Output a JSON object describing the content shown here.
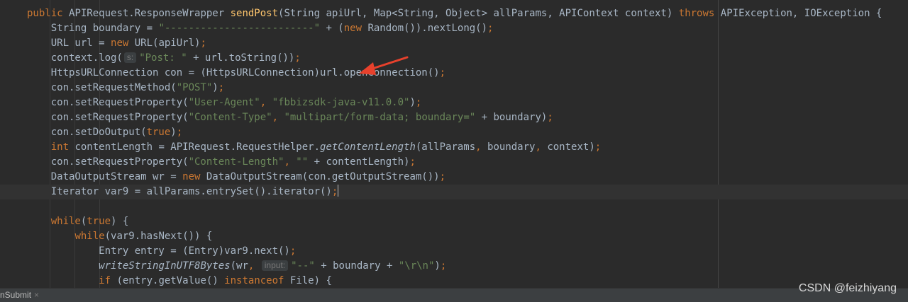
{
  "editor": {
    "lines": [
      [
        {
          "t": "public ",
          "c": "kw"
        },
        {
          "t": "APIRequest.ResponseWrapper "
        },
        {
          "t": "sendPost",
          "c": "fn"
        },
        {
          "t": "(String apiUrl, Map<String, Object> allParams, APIContext context) "
        },
        {
          "t": "throws ",
          "c": "kw"
        },
        {
          "t": "APIException, IOException {"
        }
      ],
      [
        {
          "t": "    String boundary = "
        },
        {
          "t": "\"-------------------------\"",
          "c": "str"
        },
        {
          "t": " + ("
        },
        {
          "t": "new ",
          "c": "kw"
        },
        {
          "t": "Random()).nextLong()"
        },
        {
          "t": ";",
          "c": "kw"
        }
      ],
      [
        {
          "t": "    URL url = "
        },
        {
          "t": "new ",
          "c": "kw"
        },
        {
          "t": "URL(apiUrl)"
        },
        {
          "t": ";",
          "c": "kw"
        }
      ],
      [
        {
          "t": "    context.log("
        },
        {
          "t": "s:",
          "c": "hint"
        },
        {
          "t": "\"Post: \"",
          "c": "str"
        },
        {
          "t": " + url.toString())"
        },
        {
          "t": ";",
          "c": "kw"
        }
      ],
      [
        {
          "t": "    HttpsURLConnection con = (HttpsURLConnection)url.openConnection()"
        },
        {
          "t": ";",
          "c": "kw"
        }
      ],
      [
        {
          "t": "    con.setRequestMethod("
        },
        {
          "t": "\"POST\"",
          "c": "str"
        },
        {
          "t": ")"
        },
        {
          "t": ";",
          "c": "kw"
        }
      ],
      [
        {
          "t": "    con.setRequestProperty("
        },
        {
          "t": "\"User-Agent\"",
          "c": "str"
        },
        {
          "t": ", ",
          "c": "kw"
        },
        {
          "t": "\"fbbizsdk-java-v11.0.0\"",
          "c": "str"
        },
        {
          "t": ")"
        },
        {
          "t": ";",
          "c": "kw"
        }
      ],
      [
        {
          "t": "    con.setRequestProperty("
        },
        {
          "t": "\"Content-Type\"",
          "c": "str"
        },
        {
          "t": ", ",
          "c": "kw"
        },
        {
          "t": "\"multipart/form-data; boundary=\"",
          "c": "str"
        },
        {
          "t": " + boundary)"
        },
        {
          "t": ";",
          "c": "kw"
        }
      ],
      [
        {
          "t": "    con.setDoOutput("
        },
        {
          "t": "true",
          "c": "kw"
        },
        {
          "t": ")"
        },
        {
          "t": ";",
          "c": "kw"
        }
      ],
      [
        {
          "t": "    "
        },
        {
          "t": "int ",
          "c": "kw"
        },
        {
          "t": "contentLength = APIRequest.RequestHelper."
        },
        {
          "t": "getContentLength",
          "c": "it"
        },
        {
          "t": "(allParams"
        },
        {
          "t": ", ",
          "c": "kw"
        },
        {
          "t": "boundary"
        },
        {
          "t": ", ",
          "c": "kw"
        },
        {
          "t": "context)"
        },
        {
          "t": ";",
          "c": "kw"
        }
      ],
      [
        {
          "t": "    con.setRequestProperty("
        },
        {
          "t": "\"Content-Length\"",
          "c": "str"
        },
        {
          "t": ", ",
          "c": "kw"
        },
        {
          "t": "\"\"",
          "c": "str"
        },
        {
          "t": " + contentLength)"
        },
        {
          "t": ";",
          "c": "kw"
        }
      ],
      [
        {
          "t": "    DataOutputStream wr = "
        },
        {
          "t": "new ",
          "c": "kw"
        },
        {
          "t": "DataOutputStream(con.getOutputStream())"
        },
        {
          "t": ";",
          "c": "kw"
        }
      ],
      [
        {
          "t": "    Iterator var9 = allParams.entrySet().iterator()"
        },
        {
          "t": ";",
          "c": "kw"
        },
        {
          "t": "",
          "c": "caret"
        }
      ],
      [],
      [
        {
          "t": "    "
        },
        {
          "t": "while",
          "c": "kw"
        },
        {
          "t": "("
        },
        {
          "t": "true",
          "c": "kw"
        },
        {
          "t": ") {"
        }
      ],
      [
        {
          "t": "        "
        },
        {
          "t": "while",
          "c": "kw"
        },
        {
          "t": "(var9.hasNext()) {"
        }
      ],
      [
        {
          "t": "            Entry entry = (Entry)var9.next()"
        },
        {
          "t": ";",
          "c": "kw"
        }
      ],
      [
        {
          "t": "            "
        },
        {
          "t": "writeStringInUTF8Bytes",
          "c": "it"
        },
        {
          "t": "(wr"
        },
        {
          "t": ", ",
          "c": "kw"
        },
        {
          "t": "input:",
          "c": "hint"
        },
        {
          "t": "\"--\"",
          "c": "str"
        },
        {
          "t": " + boundary + "
        },
        {
          "t": "\"\\r\\n\"",
          "c": "str"
        },
        {
          "t": ")"
        },
        {
          "t": ";",
          "c": "kw"
        }
      ],
      [
        {
          "t": "            "
        },
        {
          "t": "if ",
          "c": "kw"
        },
        {
          "t": "(entry.getValue() "
        },
        {
          "t": "instanceof ",
          "c": "kw"
        },
        {
          "t": "File) {"
        }
      ]
    ],
    "current_line_index": 12
  },
  "bottom_tab": {
    "label": "nSubmit",
    "close_glyph": "×"
  },
  "watermark": "CSDN @feizhiyang",
  "annotation": {
    "icon": "red-arrow-icon",
    "color": "#e8412c"
  },
  "colors": {
    "background": "#2b2b2b",
    "keyword": "#cc7832",
    "string": "#6a8759",
    "method_declaration": "#ffc66d",
    "default_text": "#a9b7c6"
  }
}
